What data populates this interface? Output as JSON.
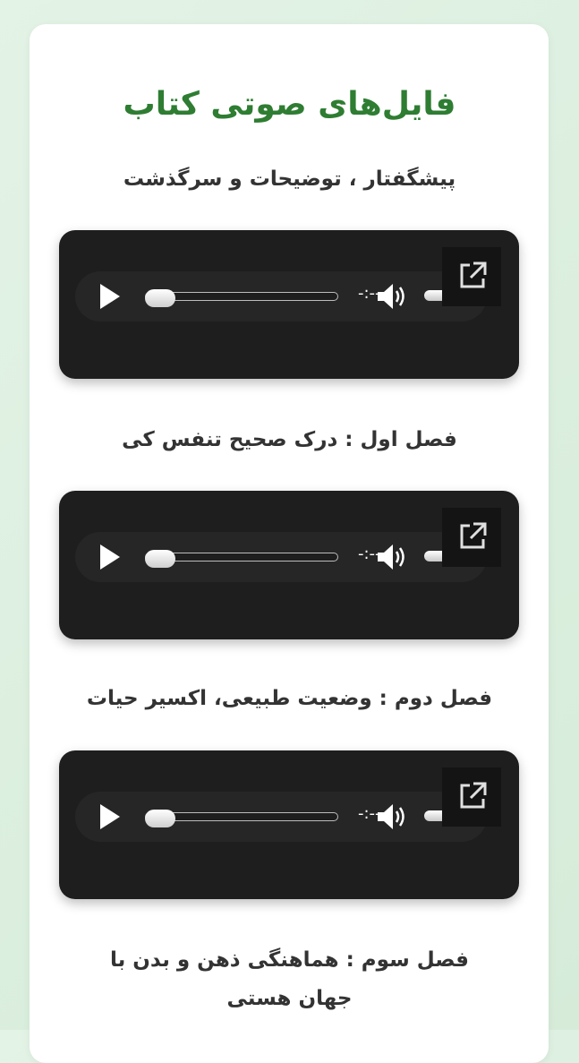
{
  "page": {
    "title": "فایل‌های صوتی کتاب"
  },
  "tracks": [
    {
      "title": "پیشگفتار ، توضیحات و سرگذشت",
      "time": "-:--"
    },
    {
      "title": "فصل اول : درک صحیح تنفس کی",
      "time": "-:--"
    },
    {
      "title": "فصل دوم : وضعیت طبیعی، اکسیر حیات",
      "time": "-:--"
    },
    {
      "title": "فصل سوم : هماهنگی ذهن و بدن با جهان هستی"
    }
  ],
  "colors": {
    "accent": "#2e7d32",
    "player_bg": "#1e1e1e",
    "page_bg": "#e3f3e6"
  },
  "icons": {
    "play": "play-icon",
    "volume": "volume-icon",
    "popout": "external-link-icon"
  }
}
